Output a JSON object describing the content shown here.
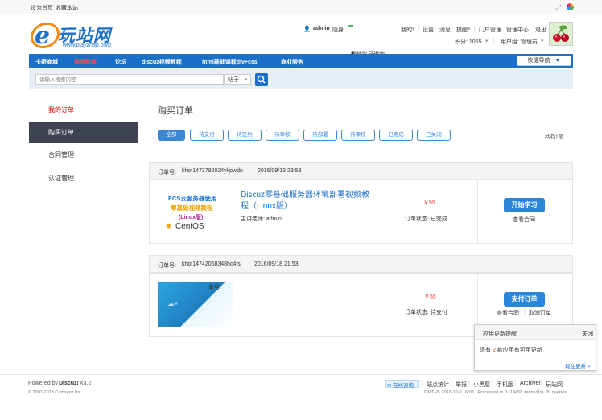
{
  "topbar": {
    "set_home": "设为首页",
    "bookmark": "收藏本站"
  },
  "brand": {
    "logo_text": "玩站网",
    "logo_url": "www.playzhan.com",
    "primary": "#1a6fc9"
  },
  "userbar": {
    "username": "admin",
    "invisible": "隐身",
    "wechat": "微信账号绑定",
    "mine": "我的",
    "settings": "设置",
    "messages": "消息",
    "reminders": "提醒",
    "portal_admin": "门户管理",
    "admin_center": "管理中心",
    "logout": "退出",
    "points": "积分: 1055",
    "usergroup": "用户组: 管理员"
  },
  "nav": {
    "items": [
      "卡密商城",
      "视频教程",
      "论坛",
      "discuz视频教程",
      "html基础课程div+css",
      "商业服务"
    ],
    "quick_nav": "快捷导航"
  },
  "search": {
    "placeholder": "请输入搜索内容",
    "type": "帖子"
  },
  "sidebar": {
    "items": [
      "我的订单",
      "购买订单",
      "合同管理",
      "认证管理"
    ]
  },
  "main": {
    "title": "购买订单",
    "tabs": [
      "全部",
      "待支付",
      "待签约",
      "待审核",
      "待部署",
      "待审核",
      "已完成",
      "已关闭"
    ],
    "total": "共有1笔"
  },
  "orders": [
    {
      "order_label": "订单号:",
      "order_no": "khot1473782024ykpwdn",
      "date": "2016/09/13 23:53",
      "thumb_lines": [
        "ECS云服务器使用",
        "零基础视频教程",
        "(Linux版)",
        "CentOS"
      ],
      "title": "Discuz零基础服务器环境部署视频教程（Linux版）",
      "teacher": "主讲老师: admin",
      "price": "￥99",
      "status": "订单状态: 已完成",
      "action": "开始学习",
      "links": [
        "查看合同"
      ]
    },
    {
      "order_label": "订单号:",
      "order_no": "khot14742068348hc4fs",
      "date": "2016/09/18 21:53",
      "thumb_text": "单号:",
      "price": "￥55",
      "status": "订单状态: 待支付",
      "action": "支付订单",
      "links": [
        "查看合同",
        "取消订单"
      ]
    }
  ],
  "popup": {
    "title": "应用更新提醒",
    "close": "关闭",
    "msg_pre": "您有",
    "msg_count": "2",
    "msg_post": "款应用有可用更新",
    "link": "现在更新 »"
  },
  "footer": {
    "powered": "Powered by",
    "discuz": "Discuz!",
    "version": "X3.2",
    "copyright": "© 2001-2013 Comsenz Inc.",
    "consult": "在线咨询",
    "links": [
      "站点统计",
      "举报",
      "小黑屋",
      "手机版",
      "Archiver",
      "玩站网"
    ],
    "gmt": "GMT+8, 2016-10-9 16:05 , Processed in 0.119458 second(s), 20 queries ."
  }
}
